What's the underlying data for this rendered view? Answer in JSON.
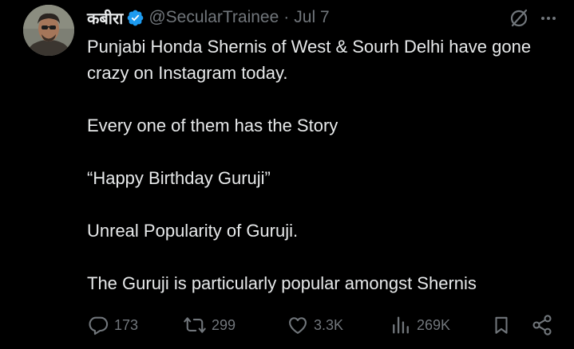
{
  "tweet": {
    "author": {
      "display_name": "कबीरा",
      "handle": "@SecularTrainee",
      "verified": true,
      "verified_color": "#1d9bf0",
      "avatar_icon": "profile-photo"
    },
    "separator": "·",
    "date": "Jul 7",
    "body": {
      "line1": "Punjabi Honda Shernis of West & Sourh Delhi have gone crazy on Instagram today.",
      "line2": "Every one of them has the Story",
      "line3": "“Happy Birthday Guruji”",
      "line4": "Unreal Popularity of Guruji.",
      "line5": "The Guruji is particularly popular amongst Shernis"
    },
    "metrics": {
      "replies": "173",
      "reposts": "299",
      "likes": "3.3K",
      "views": "269K"
    },
    "icons": {
      "grok": "grok-icon",
      "more": "more-options-icon",
      "reply": "reply-icon",
      "repost": "repost-icon",
      "like": "heart-icon",
      "views": "views-chart-icon",
      "bookmark": "bookmark-icon",
      "share": "share-icon"
    }
  },
  "colors": {
    "background": "#000000",
    "text": "#e7e9ea",
    "secondary": "#71767b"
  }
}
